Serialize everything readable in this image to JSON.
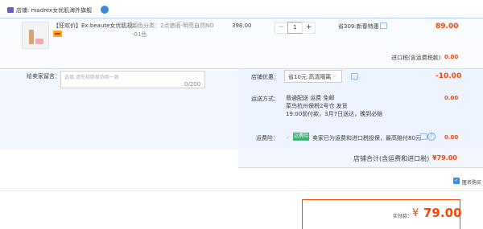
{
  "shop": {
    "label": "店铺: madrex女优肌海外旗舰"
  },
  "item": {
    "title": "【狂欢价】Ex:beaute女优肌视...",
    "sku_line1": "颜色分类：2点遮瑕-明亮自然NO",
    "sku_line2": "-01色",
    "price": "398.00",
    "quantity": "1",
    "minus": "−",
    "plus": "+",
    "promo": "省309:新春特惠",
    "subtotal": "89.00"
  },
  "tax": {
    "label": "进口税(含运费税款)",
    "value": "0.00"
  },
  "message": {
    "label": "给卖家留言：",
    "placeholder": "选填,请先和商家协商一致",
    "count": "0/200"
  },
  "coupon": {
    "label": "店铺优惠：",
    "selected": "省10元:高清隔离",
    "chevron": "⌵",
    "value": "-10.00"
  },
  "shipping": {
    "label": "运送方式：",
    "line1": "普通配送 运费 免邮",
    "line2": "菜鸟杭州保税2号仓  发货",
    "line3": "19:00前付款，3月7日送达，晚到必赔",
    "value": "0.00"
  },
  "insurance": {
    "label": "运费险：",
    "check": "✓",
    "tag": "运费险",
    "text": "卖家已为运费和进口税投保，最高赔付80元",
    "help": "?",
    "value": "0.00"
  },
  "shop_total": {
    "label": "店铺合计(含运费和进口税)",
    "value": "¥79.00"
  },
  "anonymous": {
    "check": "✓",
    "label": "匿名购买"
  },
  "pay": {
    "label": "实付款：",
    "currency": "¥",
    "value": "79.00"
  },
  "colors": {
    "accent": "#ff4400",
    "link_blue": "#3a8ee6",
    "insurance_green": "#3cb371"
  }
}
